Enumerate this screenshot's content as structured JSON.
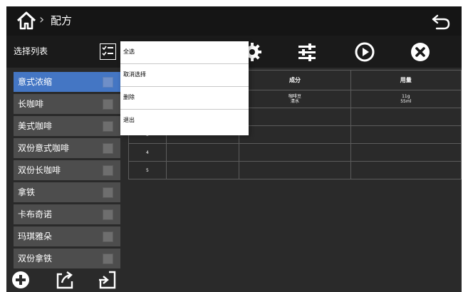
{
  "header": {
    "title": "配方",
    "separator": "›"
  },
  "sidebar": {
    "title": "选择列表",
    "items": [
      {
        "label": "意式浓缩",
        "selected": true
      },
      {
        "label": "长咖啡",
        "selected": false
      },
      {
        "label": "美式咖啡",
        "selected": false
      },
      {
        "label": "双份意式咖啡",
        "selected": false
      },
      {
        "label": "双份长咖啡",
        "selected": false
      },
      {
        "label": "拿铁",
        "selected": false
      },
      {
        "label": "卡布奇诺",
        "selected": false
      },
      {
        "label": "玛琪雅朵",
        "selected": false
      },
      {
        "label": "双份拿铁",
        "selected": false
      }
    ]
  },
  "context_menu": {
    "items": [
      "全选",
      "取消选择",
      "删除",
      "退出"
    ]
  },
  "table": {
    "headers": [
      "",
      "",
      "成分",
      "用量"
    ],
    "rows": [
      [
        "",
        "",
        "咖啡豆\n清水",
        "11g\n55ml"
      ],
      [
        "",
        "",
        "",
        ""
      ],
      [
        "3",
        "",
        "",
        ""
      ],
      [
        "4",
        "",
        "",
        ""
      ],
      [
        "5",
        "",
        "",
        ""
      ]
    ]
  },
  "icons": {
    "home": "home-icon",
    "back": "back-arrow-icon",
    "checklist": "checklist-icon",
    "settings": "gear-icon",
    "adjust": "sliders-icon",
    "play": "play-icon",
    "close": "close-icon",
    "add": "add-icon",
    "export": "export-icon",
    "import": "import-icon"
  },
  "colors": {
    "background": "#2a2a2a",
    "bar": "#151515",
    "selected": "#4476c4",
    "list_item": "#4d4d4d",
    "menu": "#ffffff"
  }
}
